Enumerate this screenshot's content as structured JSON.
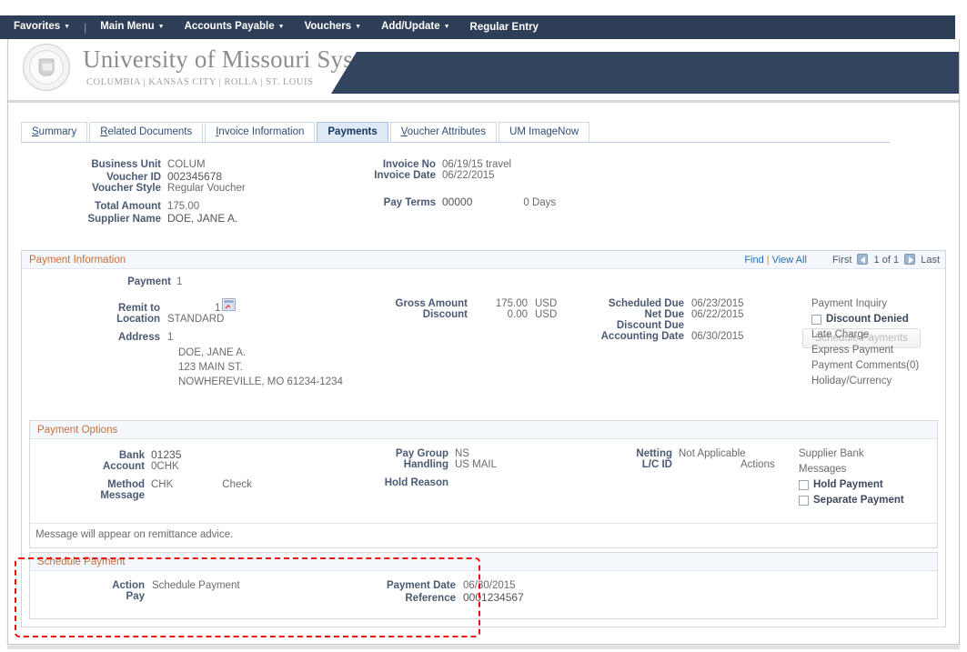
{
  "menubar": {
    "items": [
      {
        "label": "Favorites",
        "caret": true
      },
      {
        "label": "Main Menu",
        "caret": true
      },
      {
        "label": "Accounts Payable",
        "caret": true
      },
      {
        "label": "Vouchers",
        "caret": true
      },
      {
        "label": "Add/Update",
        "caret": true
      },
      {
        "label": "Regular Entry",
        "caret": false
      }
    ],
    "separator": "|"
  },
  "brand": {
    "title": "University of Missouri System",
    "subtitle": "COLUMBIA  |  KANSAS CITY  |  ROLLA  |  ST. LOUIS",
    "seal_name": "university-seal"
  },
  "tabs": [
    {
      "label": "Summary",
      "accesskey": "S",
      "active": false
    },
    {
      "label": "Related Documents",
      "accesskey": "R",
      "active": false
    },
    {
      "label": "Invoice Information",
      "accesskey": "I",
      "active": false
    },
    {
      "label": "Payments",
      "accesskey": "",
      "active": true
    },
    {
      "label": "Voucher Attributes",
      "accesskey": "V",
      "active": false
    },
    {
      "label": "UM ImageNow",
      "accesskey": "",
      "active": false
    }
  ],
  "header": {
    "business_unit_label": "Business Unit",
    "business_unit_value": "COLUM",
    "voucher_id_label": "Voucher ID",
    "voucher_id_value": "002345678",
    "voucher_style_label": "Voucher Style",
    "voucher_style_value": "Regular Voucher",
    "total_amount_label": "Total Amount",
    "total_amount_value": "175.00",
    "supplier_name_label": "Supplier Name",
    "supplier_name_value": "DOE, JANE A.",
    "invoice_no_label": "Invoice No",
    "invoice_no_value": "06/19/15 travel",
    "invoice_date_label": "Invoice Date",
    "invoice_date_value": "06/22/2015",
    "pay_terms_label": "Pay Terms",
    "pay_terms_value": "00000",
    "pay_terms_days": "0 Days",
    "schedule_payments_button": "Schedule Payments"
  },
  "payment_information": {
    "title": "Payment Information",
    "find_label": "Find",
    "view_all_label": "View All",
    "first_label": "First",
    "counter_label": "1 of 1",
    "last_label": "Last",
    "payment_label": "Payment",
    "payment_value": "1",
    "remit_to_label": "Remit to",
    "remit_to_value": "1",
    "location_label": "Location",
    "location_value": "STANDARD",
    "address_label": "Address",
    "address_value": "1",
    "address_lines": [
      "DOE, JANE A.",
      "123 MAIN ST.",
      "NOWHEREVILLE, MO 61234-1234"
    ],
    "gross_amount_label": "Gross Amount",
    "gross_amount_value": "175.00",
    "gross_amount_currency": "USD",
    "discount_label": "Discount",
    "discount_value": "0.00",
    "discount_currency": "USD",
    "scheduled_due_label": "Scheduled Due",
    "scheduled_due_value": "06/23/2015",
    "net_due_label": "Net Due",
    "net_due_value": "06/22/2015",
    "discount_due_label": "Discount Due",
    "discount_due_value": "",
    "accounting_date_label": "Accounting Date",
    "accounting_date_value": "06/30/2015",
    "links": {
      "payment_inquiry": "Payment Inquiry",
      "discount_denied": "Discount Denied",
      "late_charge": "Late Charge",
      "express_payment": "Express Payment",
      "payment_comments": "Payment Comments(0)",
      "holiday_currency": "Holiday/Currency"
    }
  },
  "payment_options": {
    "title": "Payment Options",
    "bank_label": "Bank",
    "bank_value": "01235",
    "account_label": "Account",
    "account_value": "0CHK",
    "method_label": "Method",
    "method_value": "CHK",
    "method_desc": "Check",
    "message_label": "Message",
    "pay_group_label": "Pay Group",
    "pay_group_value": "NS",
    "handling_label": "Handling",
    "handling_value": "US MAIL",
    "hold_reason_label": "Hold Reason",
    "hold_reason_value": "",
    "netting_label": "Netting",
    "netting_value": "Not Applicable",
    "lc_id_label": "L/C ID",
    "lc_id_value": "",
    "actions_label": "Actions",
    "supplier_bank_label": "Supplier Bank",
    "messages_link": "Messages",
    "hold_payment_label": "Hold Payment",
    "separate_payment_label": "Separate Payment",
    "remittance_note": "Message will appear on remittance advice."
  },
  "schedule_payment": {
    "title": "Schedule Payment",
    "action_label": "Action",
    "action_value": "Schedule Payment",
    "pay_label": "Pay",
    "pay_value": "",
    "payment_date_label": "Payment Date",
    "payment_date_value": "06/30/2015",
    "reference_label": "Reference",
    "reference_value": "0001234567"
  },
  "annotation": {
    "name": "schedule-payment-highlight",
    "color": "#e81010",
    "style": "dashed-rectangle"
  },
  "colors": {
    "menubar_bg": "#2f3e57",
    "banner_navy": "#33455e",
    "section_title_orange": "#c2703b",
    "link_blue": "#2b6cb0",
    "label_grey": "#4a5a73",
    "value_grey": "#6b6b6b",
    "active_tab_bg": "#dfeaf6",
    "annotation_red": "#e81010"
  }
}
